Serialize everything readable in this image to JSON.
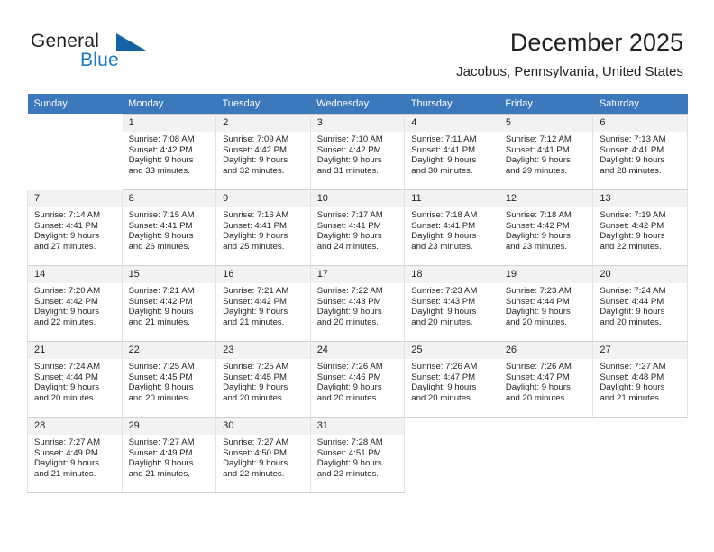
{
  "brand": {
    "name_part1": "General",
    "name_part2": "Blue",
    "triangle_icon": "triangle-logo-icon",
    "color_dark": "#231f20",
    "color_blue": "#1c7cc0",
    "color_triangle": "#1464a5"
  },
  "header": {
    "month_title": "December 2025",
    "location": "Jacobus, Pennsylvania, United States"
  },
  "calendar": {
    "header_bg": "#3b78bc",
    "daynum_bg": "#f2f2f2",
    "weekdays": [
      "Sunday",
      "Monday",
      "Tuesday",
      "Wednesday",
      "Thursday",
      "Friday",
      "Saturday"
    ],
    "weeks": [
      [
        {
          "day": "",
          "sunrise": "",
          "sunset": "",
          "daylight": "",
          "empty": true
        },
        {
          "day": "1",
          "sunrise": "Sunrise: 7:08 AM",
          "sunset": "Sunset: 4:42 PM",
          "daylight": "Daylight: 9 hours and 33 minutes."
        },
        {
          "day": "2",
          "sunrise": "Sunrise: 7:09 AM",
          "sunset": "Sunset: 4:42 PM",
          "daylight": "Daylight: 9 hours and 32 minutes."
        },
        {
          "day": "3",
          "sunrise": "Sunrise: 7:10 AM",
          "sunset": "Sunset: 4:42 PM",
          "daylight": "Daylight: 9 hours and 31 minutes."
        },
        {
          "day": "4",
          "sunrise": "Sunrise: 7:11 AM",
          "sunset": "Sunset: 4:41 PM",
          "daylight": "Daylight: 9 hours and 30 minutes."
        },
        {
          "day": "5",
          "sunrise": "Sunrise: 7:12 AM",
          "sunset": "Sunset: 4:41 PM",
          "daylight": "Daylight: 9 hours and 29 minutes."
        },
        {
          "day": "6",
          "sunrise": "Sunrise: 7:13 AM",
          "sunset": "Sunset: 4:41 PM",
          "daylight": "Daylight: 9 hours and 28 minutes."
        }
      ],
      [
        {
          "day": "7",
          "sunrise": "Sunrise: 7:14 AM",
          "sunset": "Sunset: 4:41 PM",
          "daylight": "Daylight: 9 hours and 27 minutes."
        },
        {
          "day": "8",
          "sunrise": "Sunrise: 7:15 AM",
          "sunset": "Sunset: 4:41 PM",
          "daylight": "Daylight: 9 hours and 26 minutes."
        },
        {
          "day": "9",
          "sunrise": "Sunrise: 7:16 AM",
          "sunset": "Sunset: 4:41 PM",
          "daylight": "Daylight: 9 hours and 25 minutes."
        },
        {
          "day": "10",
          "sunrise": "Sunrise: 7:17 AM",
          "sunset": "Sunset: 4:41 PM",
          "daylight": "Daylight: 9 hours and 24 minutes."
        },
        {
          "day": "11",
          "sunrise": "Sunrise: 7:18 AM",
          "sunset": "Sunset: 4:41 PM",
          "daylight": "Daylight: 9 hours and 23 minutes."
        },
        {
          "day": "12",
          "sunrise": "Sunrise: 7:18 AM",
          "sunset": "Sunset: 4:42 PM",
          "daylight": "Daylight: 9 hours and 23 minutes."
        },
        {
          "day": "13",
          "sunrise": "Sunrise: 7:19 AM",
          "sunset": "Sunset: 4:42 PM",
          "daylight": "Daylight: 9 hours and 22 minutes."
        }
      ],
      [
        {
          "day": "14",
          "sunrise": "Sunrise: 7:20 AM",
          "sunset": "Sunset: 4:42 PM",
          "daylight": "Daylight: 9 hours and 22 minutes."
        },
        {
          "day": "15",
          "sunrise": "Sunrise: 7:21 AM",
          "sunset": "Sunset: 4:42 PM",
          "daylight": "Daylight: 9 hours and 21 minutes."
        },
        {
          "day": "16",
          "sunrise": "Sunrise: 7:21 AM",
          "sunset": "Sunset: 4:42 PM",
          "daylight": "Daylight: 9 hours and 21 minutes."
        },
        {
          "day": "17",
          "sunrise": "Sunrise: 7:22 AM",
          "sunset": "Sunset: 4:43 PM",
          "daylight": "Daylight: 9 hours and 20 minutes."
        },
        {
          "day": "18",
          "sunrise": "Sunrise: 7:23 AM",
          "sunset": "Sunset: 4:43 PM",
          "daylight": "Daylight: 9 hours and 20 minutes."
        },
        {
          "day": "19",
          "sunrise": "Sunrise: 7:23 AM",
          "sunset": "Sunset: 4:44 PM",
          "daylight": "Daylight: 9 hours and 20 minutes."
        },
        {
          "day": "20",
          "sunrise": "Sunrise: 7:24 AM",
          "sunset": "Sunset: 4:44 PM",
          "daylight": "Daylight: 9 hours and 20 minutes."
        }
      ],
      [
        {
          "day": "21",
          "sunrise": "Sunrise: 7:24 AM",
          "sunset": "Sunset: 4:44 PM",
          "daylight": "Daylight: 9 hours and 20 minutes."
        },
        {
          "day": "22",
          "sunrise": "Sunrise: 7:25 AM",
          "sunset": "Sunset: 4:45 PM",
          "daylight": "Daylight: 9 hours and 20 minutes."
        },
        {
          "day": "23",
          "sunrise": "Sunrise: 7:25 AM",
          "sunset": "Sunset: 4:45 PM",
          "daylight": "Daylight: 9 hours and 20 minutes."
        },
        {
          "day": "24",
          "sunrise": "Sunrise: 7:26 AM",
          "sunset": "Sunset: 4:46 PM",
          "daylight": "Daylight: 9 hours and 20 minutes."
        },
        {
          "day": "25",
          "sunrise": "Sunrise: 7:26 AM",
          "sunset": "Sunset: 4:47 PM",
          "daylight": "Daylight: 9 hours and 20 minutes."
        },
        {
          "day": "26",
          "sunrise": "Sunrise: 7:26 AM",
          "sunset": "Sunset: 4:47 PM",
          "daylight": "Daylight: 9 hours and 20 minutes."
        },
        {
          "day": "27",
          "sunrise": "Sunrise: 7:27 AM",
          "sunset": "Sunset: 4:48 PM",
          "daylight": "Daylight: 9 hours and 21 minutes."
        }
      ],
      [
        {
          "day": "28",
          "sunrise": "Sunrise: 7:27 AM",
          "sunset": "Sunset: 4:49 PM",
          "daylight": "Daylight: 9 hours and 21 minutes."
        },
        {
          "day": "29",
          "sunrise": "Sunrise: 7:27 AM",
          "sunset": "Sunset: 4:49 PM",
          "daylight": "Daylight: 9 hours and 21 minutes."
        },
        {
          "day": "30",
          "sunrise": "Sunrise: 7:27 AM",
          "sunset": "Sunset: 4:50 PM",
          "daylight": "Daylight: 9 hours and 22 minutes."
        },
        {
          "day": "31",
          "sunrise": "Sunrise: 7:28 AM",
          "sunset": "Sunset: 4:51 PM",
          "daylight": "Daylight: 9 hours and 23 minutes."
        },
        {
          "day": "",
          "sunrise": "",
          "sunset": "",
          "daylight": "",
          "empty": true
        },
        {
          "day": "",
          "sunrise": "",
          "sunset": "",
          "daylight": "",
          "empty": true
        },
        {
          "day": "",
          "sunrise": "",
          "sunset": "",
          "daylight": "",
          "empty": true
        }
      ]
    ]
  }
}
